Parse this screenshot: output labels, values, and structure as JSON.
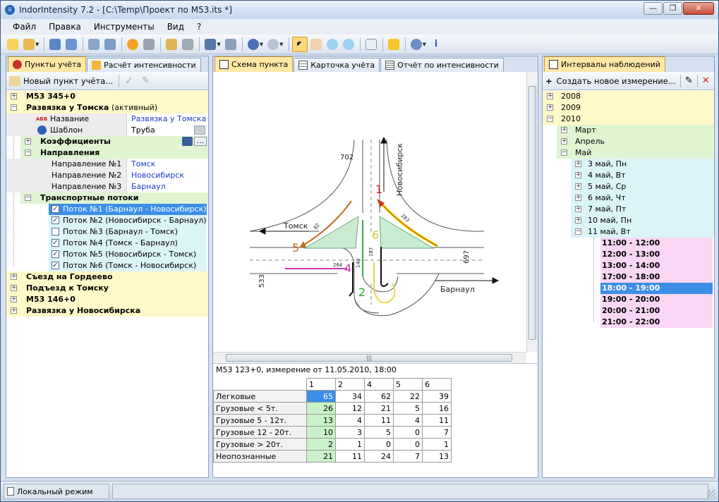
{
  "window": {
    "title": "IndorIntensity 7.2 - [C:\\Temp\\Проект по М53.its *]",
    "minimize": "—",
    "maximize": "❐",
    "close": "✕"
  },
  "menu": [
    "Файл",
    "Правка",
    "Инструменты",
    "Вид",
    "?"
  ],
  "left": {
    "tabs": [
      "Пункты учёта",
      "Расчёт интенсивности"
    ],
    "new_point": "Новый пункт учёта...",
    "tree": {
      "p1": "М53 345+0",
      "p2": "Развязка у Томска",
      "p2_active": "(активный)",
      "name_label": "Название",
      "name_value": "Развязка у Томска",
      "tpl_label": "Шаблон",
      "tpl_value": "Труба",
      "coef": "Коэффициенты",
      "dirs": "Направления",
      "d1_label": "Направление №1",
      "d1_value": "Томск",
      "d2_label": "Направление №2",
      "d2_value": "Новосибирск",
      "d3_label": "Направление №3",
      "d3_value": "Барнаул",
      "flows": "Транспортные потоки",
      "f1": "Поток №1 (Барнаул - Новосибирск)",
      "f2": "Поток №2 (Новосибирск - Барнаул)",
      "f3": "Поток №3 (Барнаул - Томск)",
      "f4": "Поток №4 (Томск - Барнаул)",
      "f5": "Поток №5 (Новосибирск - Томск)",
      "f6": "Поток №6 (Томск - Новосибирск)",
      "p3": "Съезд на Гордеево",
      "p4": "Подъезд к Томску",
      "p5": "М53 146+0",
      "p6": "Развязка у Новосибирска",
      "abv": "АБВ"
    }
  },
  "center": {
    "tabs": [
      "Схема пункта",
      "Карточка учёта",
      "Отчёт по интенсивности"
    ],
    "caption": "М53 123+0, измерение от 11.05.2010, 18:00",
    "diagram": {
      "tomsk": "Томск",
      "novosibirsk": "Новосибирск",
      "barnaul": "Барнаул",
      "n702": "702",
      "n533": "533",
      "n697": "697",
      "n82": "82",
      "n283": "283",
      "n187": "187",
      "n140": "140",
      "n264": "264",
      "f1": "1",
      "f2": "2",
      "f4": "4",
      "f5": "5",
      "f6": "6"
    },
    "table": {
      "columns": [
        "1",
        "2",
        "4",
        "5",
        "6"
      ],
      "rows": [
        {
          "label": "Легковые",
          "values": [
            "65",
            "34",
            "62",
            "22",
            "39"
          ]
        },
        {
          "label": "Грузовые < 5т.",
          "values": [
            "26",
            "12",
            "21",
            "5",
            "16"
          ]
        },
        {
          "label": "Грузовые 5 - 12т.",
          "values": [
            "13",
            "4",
            "11",
            "4",
            "11"
          ]
        },
        {
          "label": "Грузовые 12 - 20т.",
          "values": [
            "10",
            "3",
            "5",
            "0",
            "7"
          ]
        },
        {
          "label": "Грузовые > 20т.",
          "values": [
            "2",
            "1",
            "0",
            "0",
            "1"
          ]
        },
        {
          "label": "Неопознанные",
          "values": [
            "21",
            "11",
            "24",
            "7",
            "13"
          ]
        }
      ]
    }
  },
  "right": {
    "tab": "Интервалы наблюдений",
    "create": "Создать новое измерение...",
    "years": [
      "2008",
      "2009",
      "2010"
    ],
    "months": [
      "Март",
      "Апрель",
      "Май"
    ],
    "days": [
      "3 май, Пн",
      "4 май, Вт",
      "5 май, Ср",
      "6 май, Чт",
      "7 май, Пт",
      "10 май, Пн",
      "11 май, Вт"
    ],
    "intervals": [
      "11:00 - 12:00",
      "12:00 - 13:00",
      "13:00 - 14:00",
      "17:00 - 18:00",
      "18:00 - 19:00",
      "19:00 - 20:00",
      "20:00 - 21:00",
      "21:00 - 22:00"
    ]
  },
  "status": {
    "mode": "Локальный режим"
  }
}
